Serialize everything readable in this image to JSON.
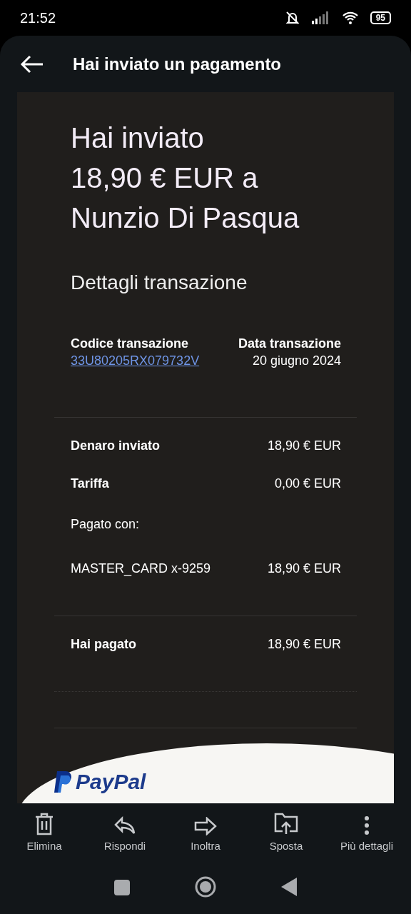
{
  "status_bar": {
    "time": "21:52",
    "battery": "95"
  },
  "app_bar": {
    "title": "Hai inviato un pagamento"
  },
  "email": {
    "headline_lines": [
      "Hai inviato",
      "18,90 € EUR a",
      "Nunzio Di Pasqua"
    ],
    "section_title": "Dettagli transazione",
    "transaction": {
      "id_label": "Codice transazione",
      "id_value": "33U80205RX079732V",
      "date_label": "Data transazione",
      "date_value": "20 giugno 2024"
    },
    "rows": [
      {
        "kind": "bold",
        "label": "Denaro inviato",
        "value": "18,90 € EUR"
      },
      {
        "kind": "bold",
        "label": "Tariffa",
        "value": "0,00 € EUR"
      },
      {
        "kind": "heading",
        "label": "Pagato con:"
      },
      {
        "kind": "plain",
        "label": "MASTER_CARD x-9259",
        "value": "18,90 € EUR"
      }
    ],
    "total": {
      "label": "Hai pagato",
      "value": "18,90 € EUR"
    },
    "logo": "PayPal"
  },
  "toolbar": [
    {
      "kind": "trash",
      "label": "Elimina"
    },
    {
      "kind": "reply",
      "label": "Rispondi"
    },
    {
      "kind": "forward",
      "label": "Inoltra"
    },
    {
      "kind": "move",
      "label": "Sposta"
    },
    {
      "kind": "more",
      "label": "Più dettagli"
    }
  ]
}
